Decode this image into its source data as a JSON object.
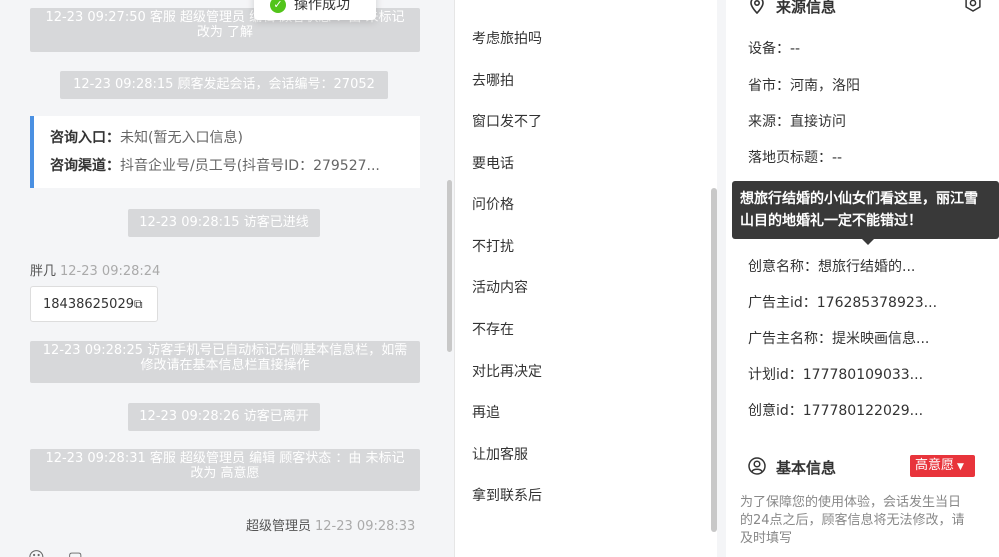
{
  "toast": {
    "text": "操作成功"
  },
  "chat": {
    "sys1": "12-23 09:27:50 客服 超级管理员 编辑 顾客状态 ：由 未标记 改为 了解",
    "sys2": "12-23 09:28:15 顾客发起会话，会话编号：27052",
    "card": {
      "entry_label": "咨询入口：",
      "entry_value": "未知(暂无入口信息)",
      "channel_label": "咨询渠道：",
      "channel_value": "抖音企业号/员工号(抖音号ID：279527..."
    },
    "sys3": "12-23 09:28:15 访客已进线",
    "visitor_name": "胖几",
    "visitor_time": "12-23 09:28:24",
    "phone": "18438625029",
    "sys4": "12-23 09:28:25 访客手机号已自动标记右侧基本信息栏，如需修改请在基本信息栏直接操作",
    "sys5": "12-23 09:28:26 访客已离开",
    "sys6": "12-23 09:28:31 客服 超级管理员 编辑 顾客状态 ：由 未标记 改为 高意愿",
    "agent_name": "超级管理员",
    "agent_time": "12-23 09:28:33"
  },
  "quick_replies": [
    "考虑旅拍吗",
    "去哪拍",
    "窗口发不了",
    "要电话",
    "问价格",
    "不打扰",
    "活动内容",
    "不存在",
    "对比再决定",
    "再追",
    "让加客服",
    "拿到联系后"
  ],
  "source": {
    "title": "来源信息",
    "fields": [
      "设备：--",
      "省市：河南，洛阳",
      "来源：直接访问",
      "落地页标题：--",
      "创意名称：想旅行结婚的...",
      "广告主id：176285378923...",
      "广告主名称：提米映画信息...",
      "计划id：177780109033...",
      "创意id：177780122029..."
    ],
    "tooltip": "想旅行结婚的小仙女们看这里，丽江雪山目的地婚礼一定不能错过！"
  },
  "basic": {
    "title": "基本信息",
    "status_badge": "高意愿",
    "note": "为了保障您的使用体验，会话发生当日的24点之后，顾客信息将无法修改，请及时填写"
  },
  "colors": {
    "accent": "#4a90e2",
    "badge": "#e8343b",
    "success": "#52c41a"
  }
}
